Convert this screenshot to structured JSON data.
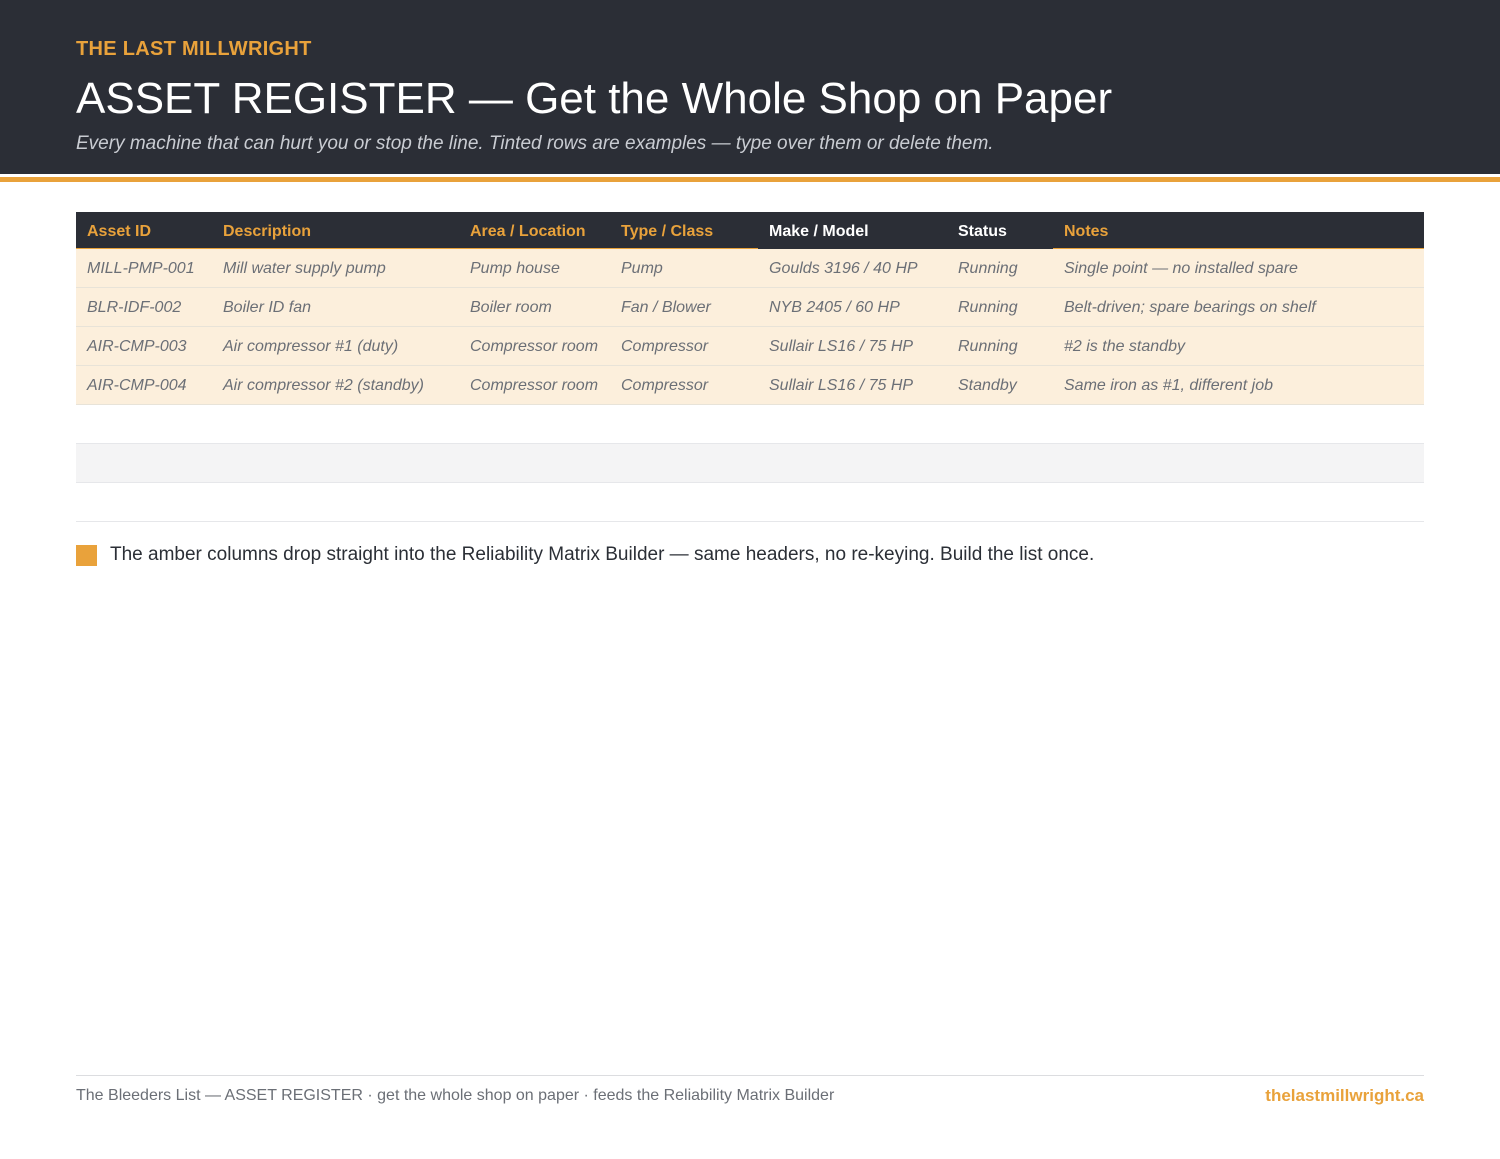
{
  "colors": {
    "amber": "#e9a23b",
    "header_bg": "#2b2e36",
    "example_row": "#fcefdc",
    "white_header_text": "#ffffff"
  },
  "header": {
    "brand": "THE LAST MILLWRIGHT",
    "title": "ASSET REGISTER — Get the Whole Shop on Paper",
    "subtitle": "Every machine that can hurt you or stop the line. Tinted rows are examples — type over them or delete them."
  },
  "table": {
    "columns": [
      {
        "label": "Asset ID",
        "amber": true
      },
      {
        "label": "Description",
        "amber": true
      },
      {
        "label": "Area / Location",
        "amber": true
      },
      {
        "label": "Type / Class",
        "amber": true
      },
      {
        "label": "Make / Model",
        "amber": false
      },
      {
        "label": "Status",
        "amber": false
      },
      {
        "label": "Notes",
        "amber": true
      }
    ],
    "rows": [
      [
        "MILL-PMP-001",
        "Mill water supply pump",
        "Pump house",
        "Pump",
        "Goulds 3196 / 40 HP",
        "Running",
        "Single point — no installed spare"
      ],
      [
        "BLR-IDF-002",
        "Boiler ID fan",
        "Boiler room",
        "Fan / Blower",
        "NYB 2405 / 60 HP",
        "Running",
        "Belt-driven; spare bearings on shelf"
      ],
      [
        "AIR-CMP-003",
        "Air compressor #1 (duty)",
        "Compressor room",
        "Compressor",
        "Sullair LS16 / 75 HP",
        "Running",
        "#2 is the standby"
      ],
      [
        "AIR-CMP-004",
        "Air compressor #2 (standby)",
        "Compressor room",
        "Compressor",
        "Sullair LS16 / 75 HP",
        "Standby",
        "Same iron as #1, different job"
      ]
    ]
  },
  "note": {
    "text": "The amber columns drop straight into the Reliability Matrix Builder — same headers, no re-keying. Build the list once."
  },
  "footer": {
    "left": "The Bleeders List — ASSET REGISTER  ·  get the whole shop on paper  ·  feeds the Reliability Matrix Builder",
    "right": "thelastmillwright.ca"
  }
}
